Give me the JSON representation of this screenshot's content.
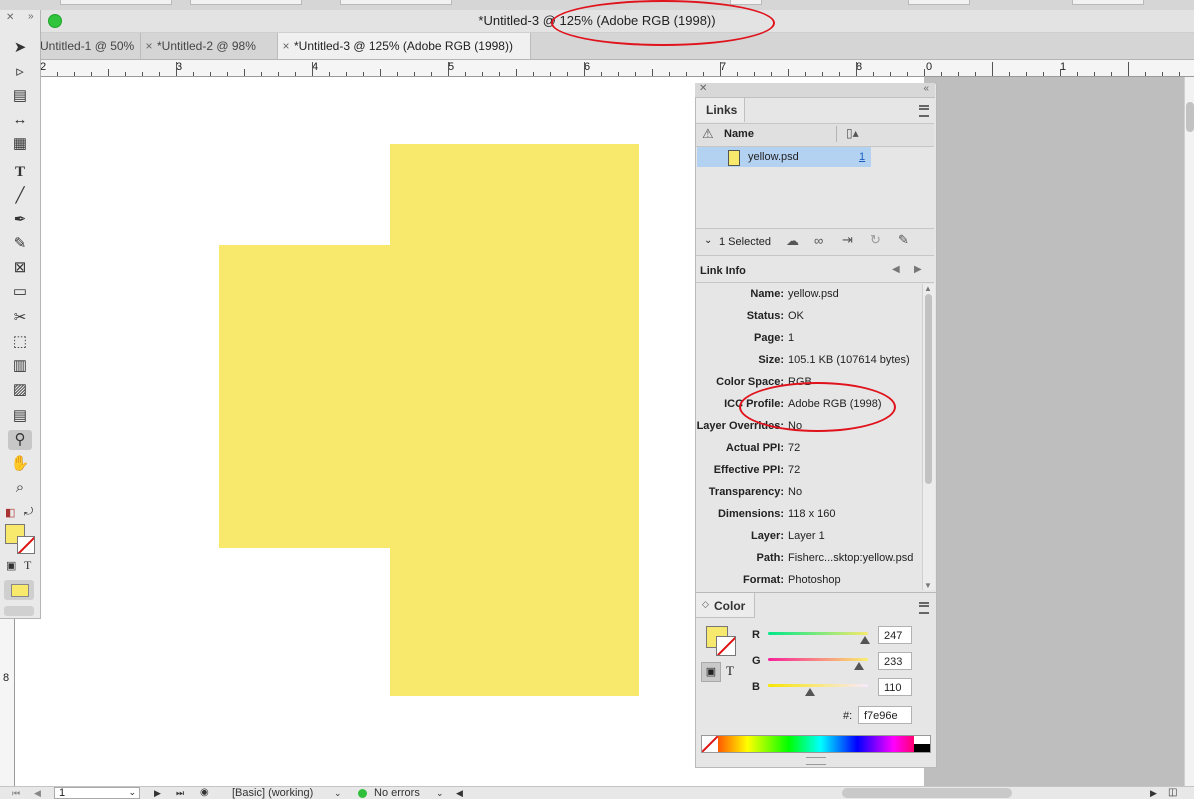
{
  "window": {
    "title": "*Untitled-3 @ 125% (Adobe RGB (1998))"
  },
  "tabs": [
    {
      "label": "Untitled-1 @ 50%"
    },
    {
      "label": "*Untitled-2 @ 98%"
    },
    {
      "label": "*Untitled-3 @ 125% (Adobe RGB (1998))"
    }
  ],
  "ruler": {
    "labels": [
      "2",
      "3",
      "4",
      "5",
      "6",
      "7",
      "8",
      "0",
      "1"
    ],
    "v_label": "8"
  },
  "links_panel": {
    "tab_label": "Links",
    "col_name": "Name",
    "item_name": "yellow.psd",
    "item_page": "1",
    "selected_label": "1 Selected",
    "link_info_label": "Link Info",
    "info": [
      {
        "label": "Name:",
        "value": "yellow.psd"
      },
      {
        "label": "Status:",
        "value": "OK"
      },
      {
        "label": "Page:",
        "value": "1"
      },
      {
        "label": "Size:",
        "value": "105.1 KB (107614 bytes)"
      },
      {
        "label": "Color Space:",
        "value": "RGB"
      },
      {
        "label": "ICC Profile:",
        "value": "Adobe RGB (1998)"
      },
      {
        "label": "Layer Overrides:",
        "value": "No"
      },
      {
        "label": "Actual PPI:",
        "value": "72"
      },
      {
        "label": "Effective PPI:",
        "value": "72"
      },
      {
        "label": "Transparency:",
        "value": "No"
      },
      {
        "label": "Dimensions:",
        "value": "118 x 160"
      },
      {
        "label": "Layer:",
        "value": "Layer 1"
      },
      {
        "label": "Path:",
        "value": "Fisherc...sktop:yellow.psd"
      },
      {
        "label": "Format:",
        "value": "Photoshop"
      }
    ]
  },
  "color_panel": {
    "tab_label": "Color",
    "r_label": "R",
    "g_label": "G",
    "b_label": "B",
    "r_value": "247",
    "g_value": "233",
    "b_value": "110",
    "hex_label": "#:",
    "hex_value": "f7e96e",
    "swatch_color": "#f7e96e"
  },
  "statusbar": {
    "page": "1",
    "preflight_profile": "[Basic] (working)",
    "errors": "No errors"
  },
  "colors": {
    "yellow": "#f8e86c",
    "annotation_red": "#e0121b",
    "selection_blue": "#b3d2f2"
  }
}
